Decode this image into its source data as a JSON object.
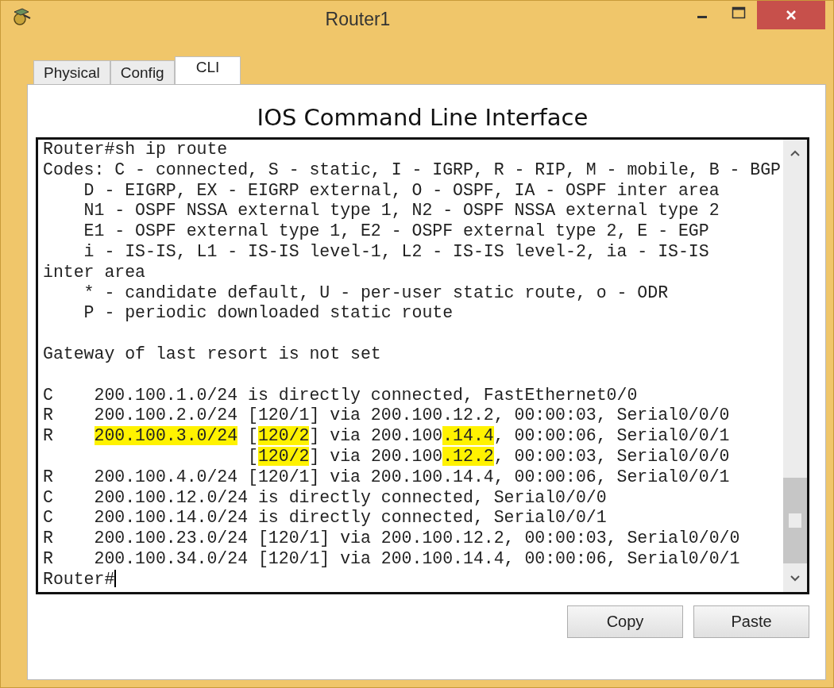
{
  "window": {
    "title": "Router1"
  },
  "tabs": [
    {
      "label": "Physical",
      "selected": false
    },
    {
      "label": "Config",
      "selected": false
    },
    {
      "label": "CLI",
      "selected": true
    }
  ],
  "heading": "IOS Command Line Interface",
  "terminal": {
    "lines": [
      {
        "kind": "text",
        "segments": [
          {
            "text": "Router#sh ip route",
            "highlight": false
          }
        ]
      },
      {
        "kind": "text",
        "segments": [
          {
            "text": "Codes: C - connected, S - static, I - IGRP, R - RIP, M - mobile, B - BGP",
            "highlight": false
          }
        ]
      },
      {
        "kind": "text",
        "segments": [
          {
            "text": "    D - EIGRP, EX - EIGRP external, O - OSPF, IA - OSPF inter area",
            "highlight": false
          }
        ]
      },
      {
        "kind": "text",
        "segments": [
          {
            "text": "    N1 - OSPF NSSA external type 1, N2 - OSPF NSSA external type 2",
            "highlight": false
          }
        ]
      },
      {
        "kind": "text",
        "segments": [
          {
            "text": "    E1 - OSPF external type 1, E2 - OSPF external type 2, E - EGP",
            "highlight": false
          }
        ]
      },
      {
        "kind": "text",
        "segments": [
          {
            "text": "    i - IS-IS, L1 - IS-IS level-1, L2 - IS-IS level-2, ia - IS-IS",
            "highlight": false
          }
        ]
      },
      {
        "kind": "text",
        "segments": [
          {
            "text": "inter area",
            "highlight": false
          }
        ]
      },
      {
        "kind": "text",
        "segments": [
          {
            "text": "    * - candidate default, U - per-user static route, o - ODR",
            "highlight": false
          }
        ]
      },
      {
        "kind": "text",
        "segments": [
          {
            "text": "    P - periodic downloaded static route",
            "highlight": false
          }
        ]
      },
      {
        "kind": "blank"
      },
      {
        "kind": "text",
        "segments": [
          {
            "text": "Gateway of last resort is not set",
            "highlight": false
          }
        ]
      },
      {
        "kind": "blank"
      },
      {
        "kind": "text",
        "segments": [
          {
            "text": "C    200.100.1.0/24 is directly connected, FastEthernet0/0",
            "highlight": false
          }
        ]
      },
      {
        "kind": "text",
        "segments": [
          {
            "text": "R    200.100.2.0/24 [120/1] via 200.100.12.2, 00:00:03, Serial0/0/0",
            "highlight": false
          }
        ]
      },
      {
        "kind": "text",
        "segments": [
          {
            "text": "R    ",
            "highlight": false
          },
          {
            "text": "200.100.3.0/24",
            "highlight": true
          },
          {
            "text": " [",
            "highlight": false
          },
          {
            "text": "120/2",
            "highlight": true
          },
          {
            "text": "] via 200.100",
            "highlight": false
          },
          {
            "text": ".14.4",
            "highlight": true
          },
          {
            "text": ", 00:00:06, Serial0/0/1",
            "highlight": false
          }
        ]
      },
      {
        "kind": "text",
        "segments": [
          {
            "text": "                    [",
            "highlight": false
          },
          {
            "text": "120/2",
            "highlight": true
          },
          {
            "text": "] via 200.100",
            "highlight": false
          },
          {
            "text": ".12.2",
            "highlight": true
          },
          {
            "text": ", 00:00:03, Serial0/0/0",
            "highlight": false
          }
        ]
      },
      {
        "kind": "text",
        "segments": [
          {
            "text": "R    200.100.4.0/24 [120/1] via 200.100.14.4, 00:00:06, Serial0/0/1",
            "highlight": false
          }
        ]
      },
      {
        "kind": "text",
        "segments": [
          {
            "text": "C    200.100.12.0/24 is directly connected, Serial0/0/0",
            "highlight": false
          }
        ]
      },
      {
        "kind": "text",
        "segments": [
          {
            "text": "C    200.100.14.0/24 is directly connected, Serial0/0/1",
            "highlight": false
          }
        ]
      },
      {
        "kind": "text",
        "segments": [
          {
            "text": "R    200.100.23.0/24 [120/1] via 200.100.12.2, 00:00:03, Serial0/0/0",
            "highlight": false
          }
        ]
      },
      {
        "kind": "text",
        "segments": [
          {
            "text": "R    200.100.34.0/24 [120/1] via 200.100.14.4, 00:00:06, Serial0/0/1",
            "highlight": false
          }
        ]
      },
      {
        "kind": "text",
        "cursor": true,
        "segments": [
          {
            "text": "Router#",
            "highlight": false
          }
        ]
      }
    ]
  },
  "buttons": [
    "Copy",
    "Paste"
  ]
}
